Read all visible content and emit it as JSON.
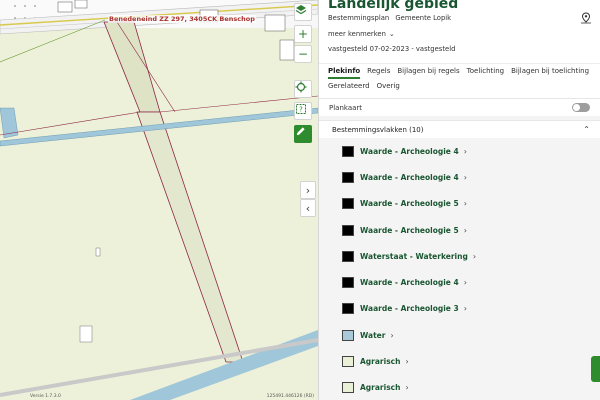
{
  "map": {
    "address_label": "Benedeneind ZZ 297, 3405CK Benschop",
    "footer_left": "Versie 1.7.3.0",
    "footer_right": "125491.446126 (RD)",
    "colors": {
      "land": "#eef1d9",
      "road": "#e8edd2",
      "plot_outline": "#8b2845",
      "water": "#9fc6d9",
      "built": "#ffffff"
    },
    "controls": {
      "layers_icon": "layers-icon",
      "zoom_in": "+",
      "zoom_out": "−",
      "locate_icon": "crosshair-icon",
      "measure_icon": "measure-icon",
      "draw_icon": "pencil-icon",
      "next": "›",
      "prev": "‹"
    }
  },
  "panel": {
    "title": "Landelijk gebied",
    "subtitle_type": "Bestemmingsplan",
    "subtitle_owner": "Gemeente Lopik",
    "more_label": "meer kenmerken",
    "status": "vastgesteld 07-02-2023 - vastgesteld",
    "tabs": [
      "Plekinfo",
      "Regels",
      "Bijlagen bij regels",
      "Toelichting",
      "Bijlagen bij toelichting",
      "Gerelateerd",
      "Overig"
    ],
    "toggle_label": "Plankaart",
    "section_title": "Bestemmingsvlakken (10)",
    "items": [
      {
        "label": "Waarde - Archeologie 4",
        "color": "#000000"
      },
      {
        "label": "Waarde - Archeologie 4",
        "color": "#000000"
      },
      {
        "label": "Waarde - Archeologie 5",
        "color": "#000000"
      },
      {
        "label": "Waarde - Archeologie 5",
        "color": "#000000"
      },
      {
        "label": "Waterstaat - Waterkering",
        "color": "#000000"
      },
      {
        "label": "Waarde - Archeologie 4",
        "color": "#000000"
      },
      {
        "label": "Waarde - Archeologie 3",
        "color": "#000000"
      },
      {
        "label": "Water",
        "color": "#a9c8d8"
      },
      {
        "label": "Agrarisch",
        "color": "#eaf0d5"
      },
      {
        "label": "Agrarisch",
        "color": "#eaf0d5"
      }
    ],
    "accent": "#2e7d32"
  }
}
